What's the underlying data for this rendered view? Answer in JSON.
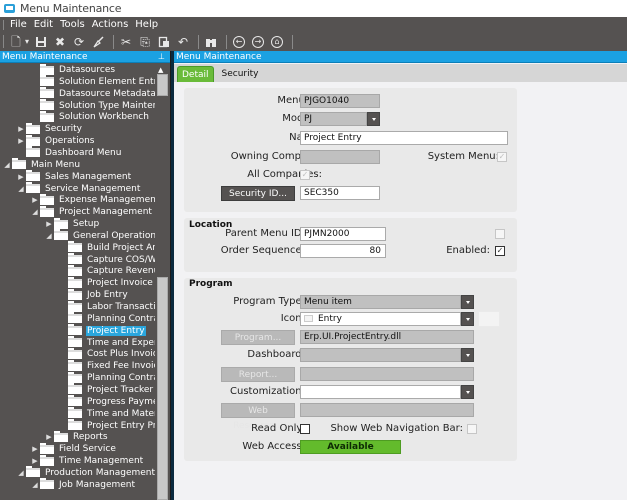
{
  "window": {
    "title": "Menu Maintenance",
    "icon": "app-window-icon"
  },
  "menubar": {
    "items": [
      "File",
      "Edit",
      "Tools",
      "Actions",
      "Help"
    ]
  },
  "toolbar": {
    "buttons": [
      {
        "name": "new-icon",
        "glyph": "🗋"
      },
      {
        "name": "new-dropdown-icon",
        "glyph": "▾"
      },
      {
        "name": "save-icon",
        "glyph": "💾"
      },
      {
        "name": "delete-icon",
        "glyph": "✖"
      },
      {
        "name": "refresh-icon",
        "glyph": "⟳"
      },
      {
        "name": "clear-icon",
        "glyph": "🧹"
      },
      {
        "name": "cut-icon",
        "glyph": "✂"
      },
      {
        "name": "copy-icon",
        "glyph": "⎘"
      },
      {
        "name": "paste-icon",
        "glyph": "📋"
      },
      {
        "name": "undo-icon",
        "glyph": "↶"
      },
      {
        "name": "search-binoculars-icon",
        "glyph": "⚲"
      },
      {
        "name": "back-icon",
        "glyph": "←"
      },
      {
        "name": "forward-icon",
        "glyph": "→"
      },
      {
        "name": "home-icon",
        "glyph": "⌂"
      }
    ]
  },
  "left_panel": {
    "title": "Menu Maintenance",
    "pin_icon": "pin-icon",
    "tree": [
      {
        "label": "Datasources",
        "level": 4,
        "expander": "none"
      },
      {
        "label": "Solution Element Entry",
        "level": 4,
        "expander": "none"
      },
      {
        "label": "Datasource Metadata",
        "level": 4,
        "expander": "none"
      },
      {
        "label": "Solution Type Maintenanc",
        "level": 4,
        "expander": "none"
      },
      {
        "label": "Solution Workbench",
        "level": 4,
        "expander": "none"
      },
      {
        "label": "Security",
        "level": 3,
        "expander": "collapsed"
      },
      {
        "label": "Operations",
        "level": 3,
        "expander": "collapsed"
      },
      {
        "label": "Dashboard Menu",
        "level": 3,
        "expander": "none"
      },
      {
        "label": "Main Menu",
        "level": 2,
        "expander": "expanded"
      },
      {
        "label": "Sales Management",
        "level": 3,
        "expander": "collapsed"
      },
      {
        "label": "Service Management",
        "level": 3,
        "expander": "expanded"
      },
      {
        "label": "Expense Management",
        "level": 4,
        "expander": "collapsed"
      },
      {
        "label": "Project Management",
        "level": 4,
        "expander": "expanded"
      },
      {
        "label": "Setup",
        "level": 5,
        "expander": "collapsed"
      },
      {
        "label": "General Operations",
        "level": 5,
        "expander": "expanded"
      },
      {
        "label": "Build Project Anal",
        "level": 6,
        "expander": "none"
      },
      {
        "label": "Capture COS/WIP",
        "level": 6,
        "expander": "none"
      },
      {
        "label": "Capture Revenue",
        "level": 6,
        "expander": "none"
      },
      {
        "label": "Project Invoice Pr",
        "level": 6,
        "expander": "none"
      },
      {
        "label": "Job Entry",
        "level": 6,
        "expander": "none"
      },
      {
        "label": "Labor Transaction",
        "level": 6,
        "expander": "none"
      },
      {
        "label": "Planning Contract",
        "level": 6,
        "expander": "none"
      },
      {
        "label": "Project Entry",
        "level": 6,
        "expander": "none",
        "selected": true
      },
      {
        "label": "Time and Expens",
        "level": 6,
        "expander": "none"
      },
      {
        "label": "Cost Plus Invoice",
        "level": 6,
        "expander": "none"
      },
      {
        "label": "Fixed Fee Invoice",
        "level": 6,
        "expander": "none"
      },
      {
        "label": "Planning Contract",
        "level": 6,
        "expander": "none"
      },
      {
        "label": "Project Tracker",
        "level": 6,
        "expander": "none"
      },
      {
        "label": "Progress Payment",
        "level": 6,
        "expander": "none"
      },
      {
        "label": "Time and Material",
        "level": 6,
        "expander": "none"
      },
      {
        "label": "Project Entry Proj",
        "level": 6,
        "expander": "none"
      },
      {
        "label": "Reports",
        "level": 5,
        "expander": "collapsed"
      },
      {
        "label": "Field Service",
        "level": 4,
        "expander": "collapsed"
      },
      {
        "label": "Time Management",
        "level": 4,
        "expander": "collapsed"
      },
      {
        "label": "Production Management",
        "level": 3,
        "expander": "expanded"
      },
      {
        "label": "Job Management",
        "level": 4,
        "expander": "expanded"
      }
    ]
  },
  "right_panel": {
    "title": "Menu Maintenance",
    "tabs": [
      {
        "label": "Detail",
        "active": true
      },
      {
        "label": "Security",
        "active": false
      }
    ],
    "detail": {
      "menu_id": {
        "label": "Menu ID:",
        "value": "PJGO1040"
      },
      "module": {
        "label": "Module:",
        "value": "PJ"
      },
      "name": {
        "label": "Name:",
        "value": "Project Entry"
      },
      "owning_company": {
        "label": "Owning Company:",
        "value": ""
      },
      "system_menu": {
        "label": "System Menu:",
        "checked": true,
        "enabled": false
      },
      "all_companies": {
        "label": "All Companies:",
        "checked": true,
        "enabled": false
      },
      "security_id": {
        "button": "Security ID...",
        "value": "SEC350"
      }
    },
    "location": {
      "title": "Location",
      "parent_menu_id": {
        "label": "Parent Menu ID:",
        "value": "PJMN2000"
      },
      "order_sequence": {
        "label": "Order Sequence:",
        "value": "80"
      },
      "unlabeled_check": {
        "checked": false,
        "enabled": false
      },
      "enabled": {
        "label": "Enabled:",
        "checked": true
      }
    },
    "program": {
      "title": "Program",
      "program_type": {
        "label": "Program Type:",
        "value": "Menu item"
      },
      "icon": {
        "label": "Icon:",
        "value": "Entry"
      },
      "program": {
        "button": "Program...",
        "value": "Erp.UI.ProjectEntry.dll"
      },
      "dashboard": {
        "label": "Dashboard:",
        "value": ""
      },
      "report": {
        "button": "Report...",
        "value": ""
      },
      "customization": {
        "label": "Customization:",
        "value": ""
      },
      "web_resource": {
        "button": "Web Resource...",
        "value": ""
      },
      "read_only": {
        "label": "Read Only:",
        "checked": false
      },
      "show_web_nav_bar": {
        "label": "Show Web Navigation Bar:",
        "checked": false,
        "enabled": false
      },
      "web_access": {
        "label": "Web Access:",
        "value": "Available",
        "color": "#63bb2c"
      }
    }
  },
  "scrollbar": {
    "tree_scroll_position": 0.55
  }
}
